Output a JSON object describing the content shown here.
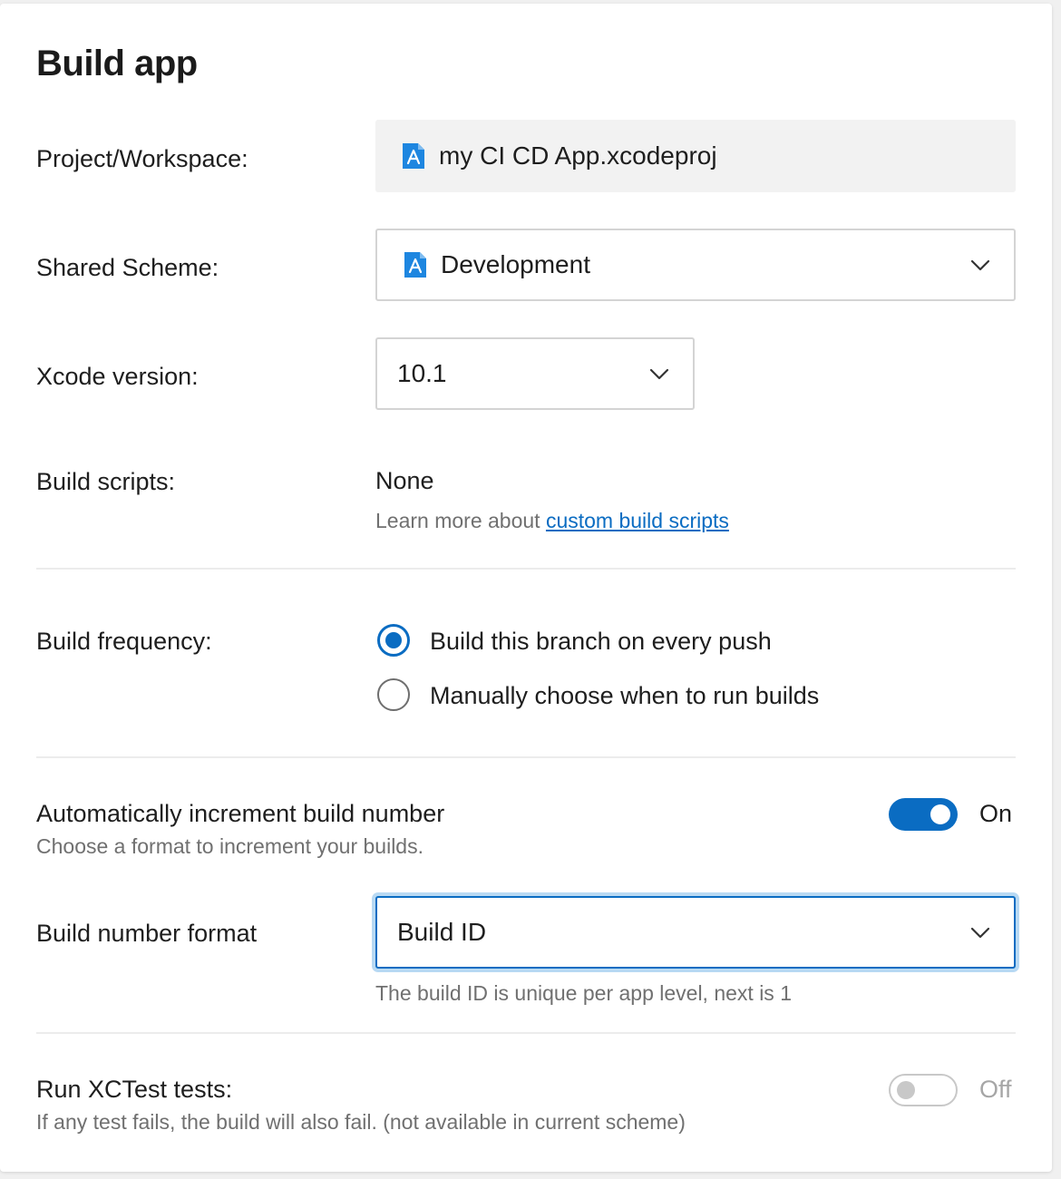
{
  "header": {
    "title": "Build app"
  },
  "project": {
    "label": "Project/Workspace:",
    "value": "my CI CD App.xcodeproj",
    "icon": "xcode-project-icon"
  },
  "scheme": {
    "label": "Shared Scheme:",
    "value": "Development",
    "icon": "xcode-scheme-icon"
  },
  "xcode": {
    "label": "Xcode version:",
    "value": "10.1"
  },
  "scripts": {
    "label": "Build scripts:",
    "value": "None",
    "help_prefix": "Learn more about ",
    "help_link": "custom build scripts"
  },
  "frequency": {
    "label": "Build frequency:",
    "options": [
      {
        "label": "Build this branch on every push",
        "selected": true
      },
      {
        "label": "Manually choose when to run builds",
        "selected": false
      }
    ]
  },
  "increment": {
    "title": "Automatically increment build number",
    "subtitle": "Choose a format to increment your builds.",
    "state_label": "On",
    "enabled": true
  },
  "build_number_format": {
    "label": "Build number format",
    "value": "Build ID",
    "help": "The build ID is unique per app level, next is 1"
  },
  "xctest": {
    "title": "Run XCTest tests:",
    "subtitle": "If any test fails, the build will also fail. (not available in current scheme)",
    "state_label": "Off",
    "enabled": false
  },
  "colors": {
    "accent": "#0a6cc2",
    "text": "#1e1e1e",
    "muted": "#707070",
    "readonly_bg": "#f2f2f2",
    "border": "#d4d4d4"
  }
}
